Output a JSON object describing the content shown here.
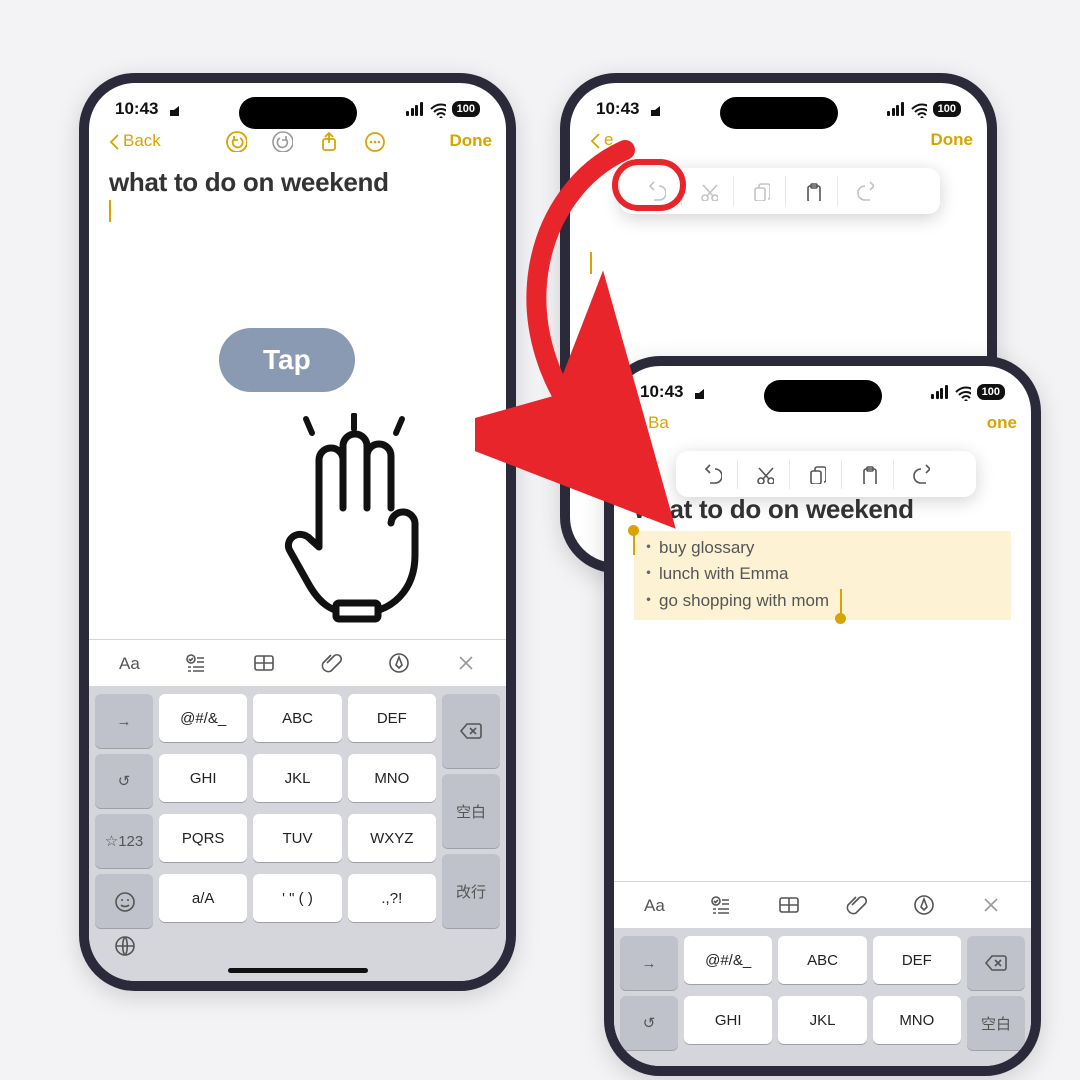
{
  "status": {
    "time": "10:43",
    "battery": "100"
  },
  "nav": {
    "back": "Back",
    "done": "Done"
  },
  "note_title": "what to do on weekend",
  "tap_label": "Tap",
  "todo": {
    "item1": "buy glossary",
    "item2": "lunch with Emma",
    "item3": "go shopping with mom"
  },
  "keys": {
    "sym": "@#/&_",
    "abc": "ABC",
    "def": "DEF",
    "ghi": "GHI",
    "jkl": "JKL",
    "mno": "MNO",
    "pqrs": "PQRS",
    "tuv": "TUV",
    "wxyz": "WXYZ",
    "aA": "a/A",
    "quote": "' \" ( )",
    "punct": ".,?!",
    "star123": "☆123",
    "space": "空白",
    "enter": "改行"
  },
  "nav_partial_ba": "Ba",
  "nav_partial_one": "one",
  "nav_partial_e": "e"
}
